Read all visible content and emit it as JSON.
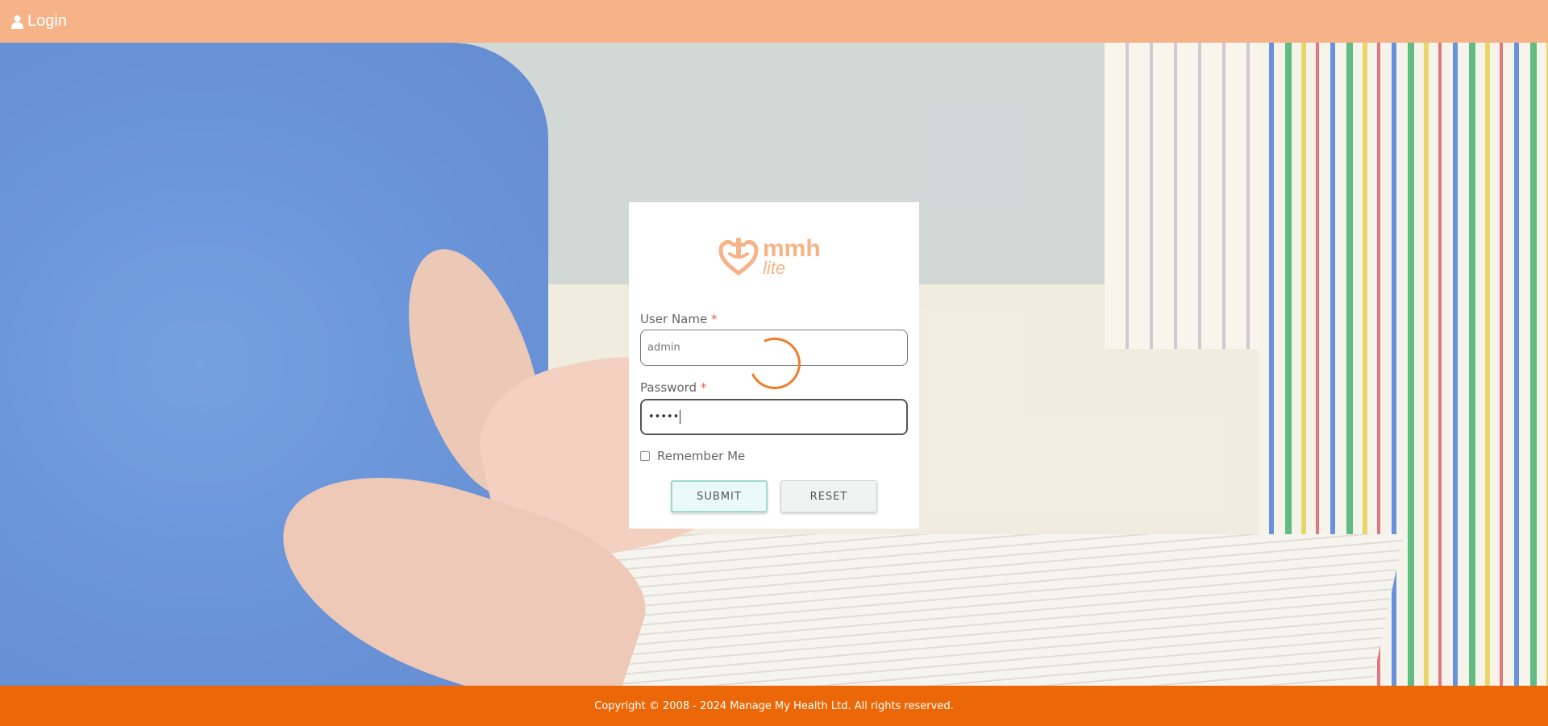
{
  "header": {
    "title": "Login",
    "icon": "user-icon"
  },
  "logo": {
    "icon": "heart-hands-icon",
    "brand_main": "mmh",
    "brand_sub": "lite",
    "color": "#f6b387"
  },
  "form": {
    "username_label": "User Name",
    "username_required": "*",
    "username_value": "admin",
    "password_label": "Password",
    "password_required": "*",
    "password_value": "•••••",
    "remember_label": "Remember Me",
    "remember_checked": false,
    "submit_label": "SUBMIT",
    "reset_label": "RESET"
  },
  "footer": {
    "copyright": "Copyright © 2008 - 2024 Manage My Health Ltd. All rights reserved."
  },
  "colors": {
    "topbar": "#f6b387",
    "footer": "#ec6707",
    "spinner": "#ef7d2a",
    "submit_border": "#9fdcc8"
  }
}
